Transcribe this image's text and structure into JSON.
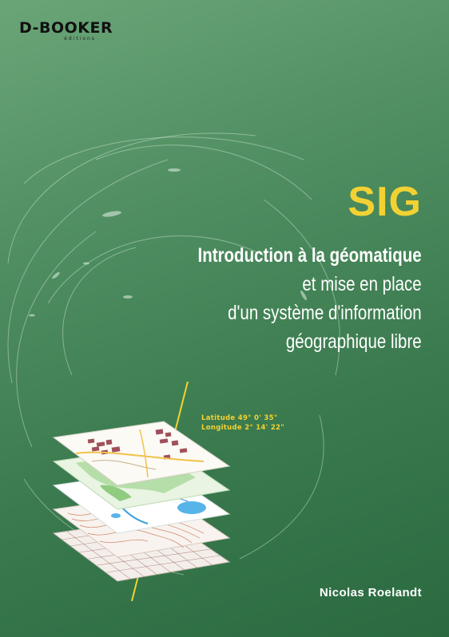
{
  "publisher": {
    "logo_text": "D-BOOKER",
    "logo_sub": "éditions"
  },
  "book": {
    "title": "SIG",
    "subtitle_bold": "Introduction à la géomatique",
    "subtitle_lines": [
      "et mise en place",
      "d'un système d'information",
      "géographique libre"
    ],
    "author": "Nicolas Roelandt"
  },
  "illustration": {
    "latitude": "Latitude 49° 0' 35\"",
    "longitude": "Longitude 2° 14' 22\"",
    "layer_icons": [
      "map-layer-urban",
      "map-layer-vegetation",
      "map-layer-hydrography",
      "map-layer-contours",
      "map-layer-grid"
    ]
  },
  "colors": {
    "background": "#3f8052",
    "title": "#f2d233",
    "text": "#ffffff"
  }
}
